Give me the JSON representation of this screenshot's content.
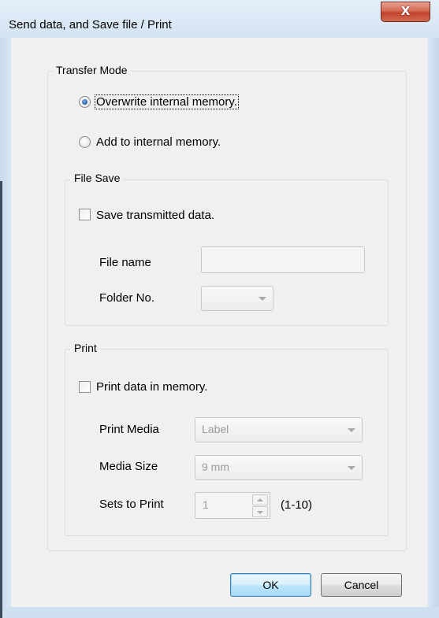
{
  "window": {
    "title": "Send data, and Save file / Print",
    "close_glyph": "X"
  },
  "transfer_mode": {
    "legend": "Transfer Mode",
    "options": [
      {
        "label": "Overwrite internal memory.",
        "checked": true
      },
      {
        "label": "Add to internal memory.",
        "checked": false
      }
    ]
  },
  "file_save": {
    "legend": "File Save",
    "checkbox_label": "Save transmitted data.",
    "checked": false,
    "file_name_label": "File name",
    "file_name_value": "",
    "folder_no_label": "Folder No.",
    "folder_no_value": ""
  },
  "print": {
    "legend": "Print",
    "checkbox_label": "Print data in memory.",
    "checked": false,
    "print_media_label": "Print Media",
    "print_media_value": "Label",
    "media_size_label": "Media Size",
    "media_size_value": "9 mm",
    "sets_label": "Sets to Print",
    "sets_value": "1",
    "sets_range": "(1-10)"
  },
  "buttons": {
    "ok": "OK",
    "cancel": "Cancel"
  },
  "colors": {
    "client_bg": "#f0f0f0",
    "frame": "#cfe0f1",
    "close_button": "#c94a32",
    "ok_border": "#3c7fb1"
  }
}
